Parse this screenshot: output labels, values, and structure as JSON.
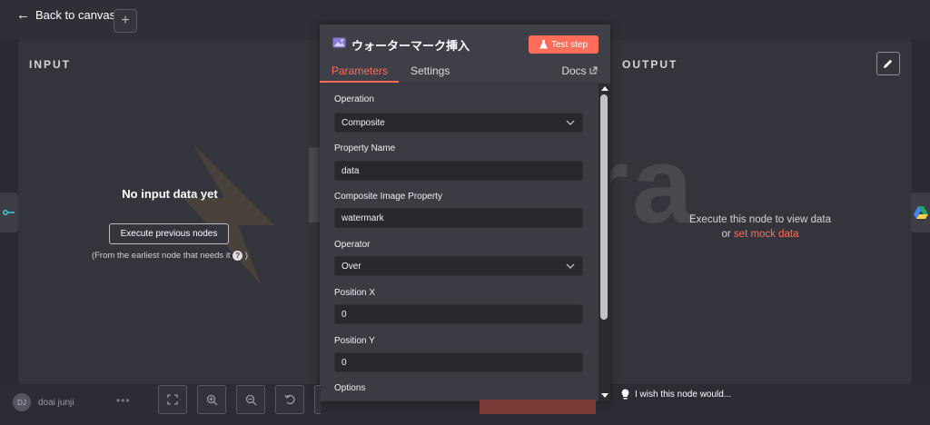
{
  "header": {
    "back_label": "Back to canvas",
    "add_label": "+"
  },
  "input_panel": {
    "title": "INPUT",
    "no_data": "No input data yet",
    "execute_button": "Execute previous nodes",
    "hint": "(From the earliest node that needs it",
    "hint_end": ")"
  },
  "output_panel": {
    "title": "OUTPUT",
    "message": "Execute this node to view data",
    "or": "or",
    "mock_link": "set mock data"
  },
  "node": {
    "title": "ウォーターマーク挿入",
    "test_button": "Test step",
    "tabs": {
      "parameters": "Parameters",
      "settings": "Settings",
      "docs": "Docs"
    }
  },
  "form": {
    "operation": {
      "label": "Operation",
      "value": "Composite"
    },
    "property_name": {
      "label": "Property Name",
      "value": "data"
    },
    "composite_image_property": {
      "label": "Composite Image Property",
      "value": "watermark"
    },
    "operator": {
      "label": "Operator",
      "value": "Over"
    },
    "position_x": {
      "label": "Position X",
      "value": "0"
    },
    "position_y": {
      "label": "Position Y",
      "value": "0"
    },
    "options": {
      "label": "Options"
    }
  },
  "watermark_text": "Digicra",
  "footer": {
    "user_initials": "DJ",
    "user_name": "doai junji",
    "user_menu": "•••",
    "wish_text": "I wish this node would..."
  },
  "colors": {
    "accent": "#ff6d5a",
    "panel": "#34343c",
    "field": "#28282e"
  }
}
